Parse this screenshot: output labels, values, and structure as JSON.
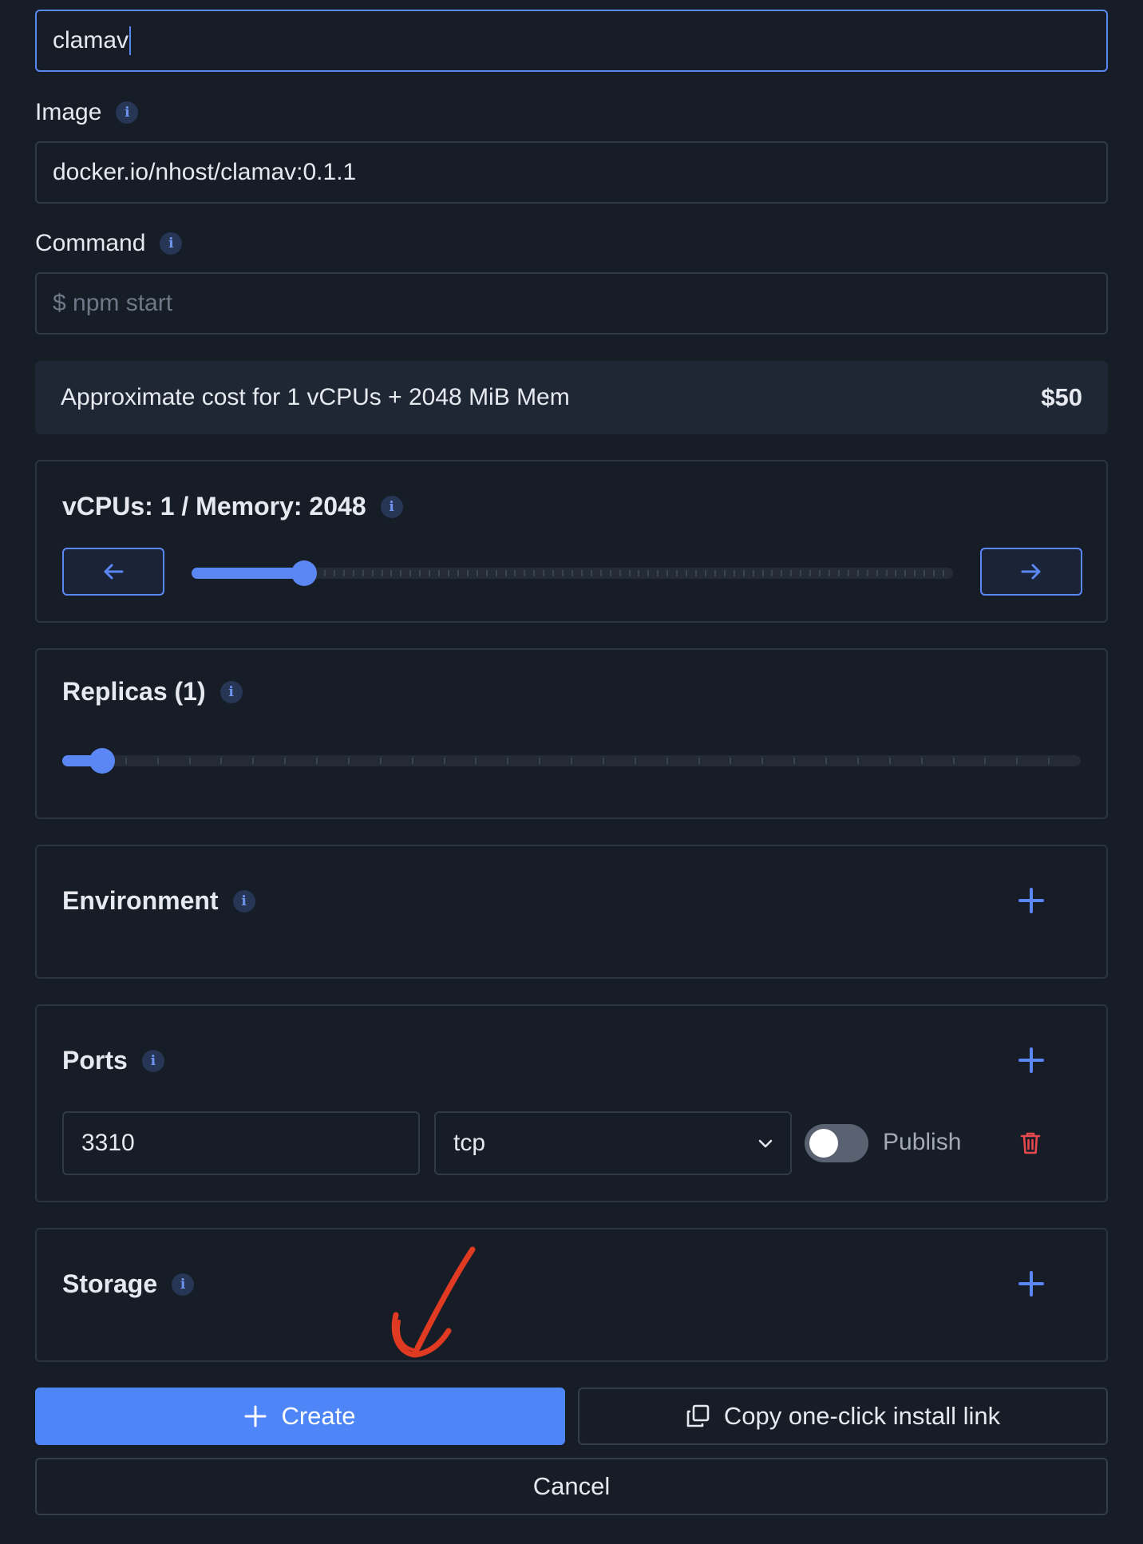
{
  "name_field": {
    "value": "clamav"
  },
  "image_field": {
    "label": "Image",
    "value": "docker.io/nhost/clamav:0.1.1"
  },
  "command_field": {
    "label": "Command",
    "placeholder": "$ npm start"
  },
  "cost": {
    "text": "Approximate cost for 1 vCPUs + 2048 MiB Mem",
    "price": "$50"
  },
  "compute": {
    "title": "vCPUs: 1 / Memory: 2048",
    "level_fraction": 0.135
  },
  "replicas": {
    "title": "Replicas (1)",
    "level_fraction": 0.03
  },
  "environment": {
    "title": "Environment"
  },
  "ports": {
    "title": "Ports",
    "port_value": "3310",
    "protocol": "tcp",
    "publish_label": "Publish",
    "publish_enabled": false
  },
  "storage": {
    "title": "Storage"
  },
  "actions": {
    "create_label": "Create",
    "copy_label": "Copy one-click install link",
    "cancel_label": "Cancel"
  },
  "colors": {
    "accent": "#4f86f7",
    "danger": "#e5484d",
    "annotation": "#e03a22",
    "background": "#171d27"
  },
  "icons": [
    "info-icon",
    "arrow-left-icon",
    "arrow-right-icon",
    "plus-icon",
    "chevron-down-icon",
    "trash-icon",
    "copy-icon"
  ]
}
